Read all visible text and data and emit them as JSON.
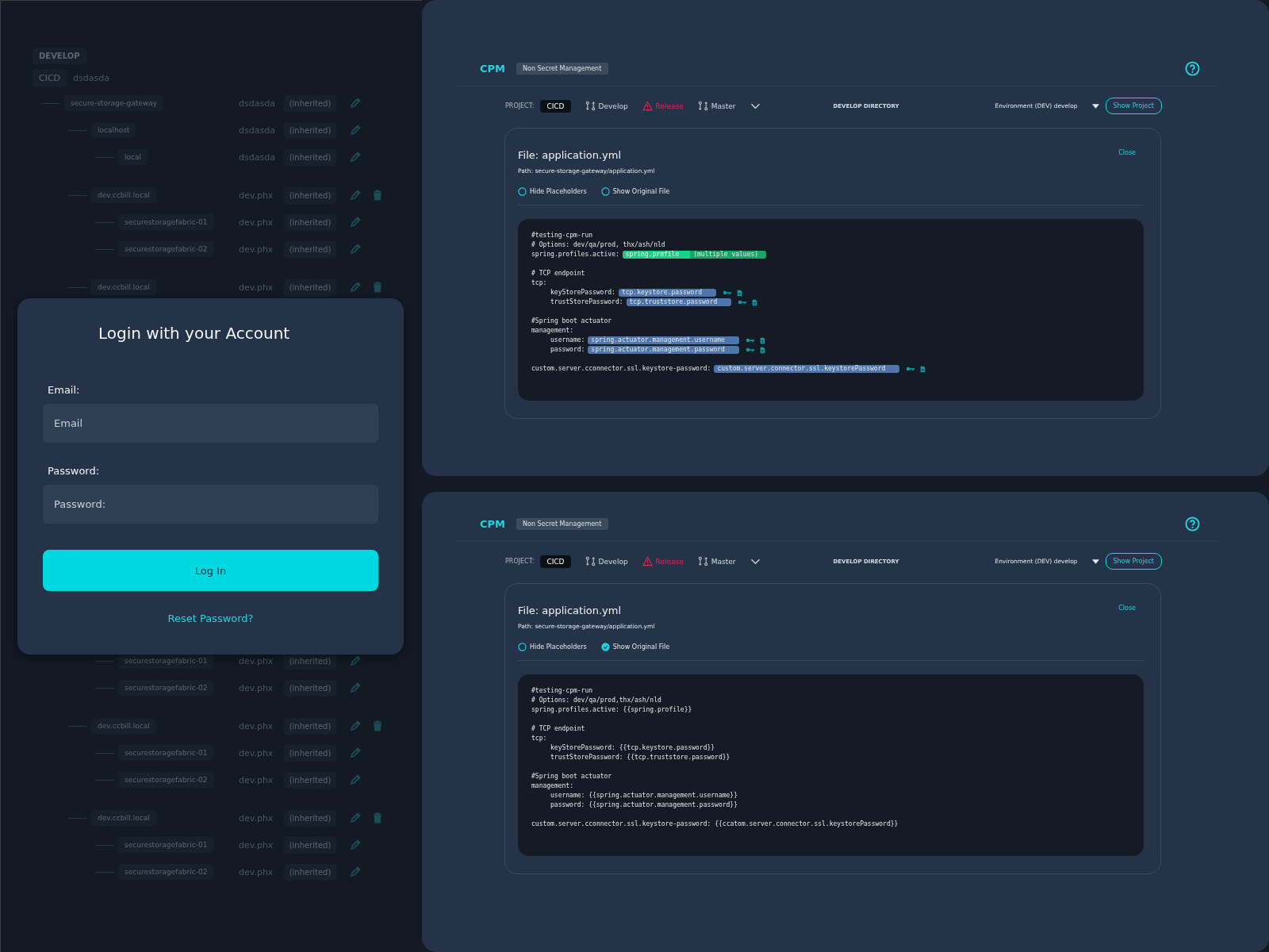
{
  "background": {
    "section": "DEVELOP",
    "project": "CICD",
    "value": "dsdasda",
    "tree": [
      {
        "name": "secure-storage-gateway",
        "value": "dsdasda",
        "tag": "(inherited)",
        "deletable": false,
        "children": [
          {
            "name": "localhost",
            "value": "dsdasda",
            "tag": "(inherited)",
            "deletable": false,
            "children": [
              {
                "name": "local",
                "value": "dsdasda",
                "tag": "(inherited)",
                "deletable": false
              }
            ]
          },
          {
            "name": "dev.ccbill.local",
            "value": "dev.phx",
            "tag": "(inherited)",
            "deletable": true,
            "children": [
              {
                "name": "securestoragefabric-01",
                "value": "dev.phx",
                "tag": "(inherited)",
                "deletable": false
              },
              {
                "name": "securestoragefabric-02",
                "value": "dev.phx",
                "tag": "(inherited)",
                "deletable": false
              }
            ]
          },
          {
            "name": "dev.ccbill.local",
            "value": "dev.phx",
            "tag": "(inherited)",
            "deletable": true
          }
        ]
      }
    ],
    "tree_lower": [
      {
        "children": [
          {
            "name": "securestoragefabric-01",
            "value": "dev.phx",
            "tag": "(inherited)",
            "deletable": false
          },
          {
            "name": "securestoragefabric-02",
            "value": "dev.phx",
            "tag": "(inherited)",
            "deletable": false
          }
        ]
      },
      {
        "name": "dev.ccbill.local",
        "value": "dev.phx",
        "tag": "(inherited)",
        "deletable": true,
        "children": [
          {
            "name": "securestoragefabric-01",
            "value": "dev.phx",
            "tag": "(inherited)",
            "deletable": false
          },
          {
            "name": "securestoragefabric-02",
            "value": "dev.phx",
            "tag": "(inherited)",
            "deletable": false
          }
        ]
      },
      {
        "name": "dev.ccbill.local",
        "value": "dev.phx",
        "tag": "(inherited)",
        "deletable": true,
        "children": [
          {
            "name": "securestoragefabric-01",
            "value": "dev.phx",
            "tag": "(inherited)",
            "deletable": false
          },
          {
            "name": "securestoragefabric-02",
            "value": "dev.phx",
            "tag": "(inherited)",
            "deletable": false
          }
        ]
      }
    ]
  },
  "login": {
    "title": "Login with your Account",
    "email_label": "Email:",
    "email_placeholder": "Email",
    "password_label": "Password:",
    "password_placeholder": "Password:",
    "button": "Log In",
    "reset_link": "Reset Password?"
  },
  "panels": [
    {
      "app": "CPM",
      "section": "Non Secret Management",
      "project_label": "PROJECT:",
      "project": "CICD",
      "branches": [
        {
          "label": "Develop",
          "kind": "branch"
        },
        {
          "label": "Release",
          "kind": "warning"
        },
        {
          "label": "Master",
          "kind": "branch"
        }
      ],
      "directory": "DEVELOP DIRECTORY",
      "environment": "Environment (DEV) develop",
      "show_button": "Show Project",
      "file": {
        "title": "File: application.yml",
        "path": "Path: secure-storage-gateway/application.yml",
        "close": "Close",
        "options": [
          {
            "label": "Hide Placeholders",
            "checked": false
          },
          {
            "label": "Show Original File",
            "checked": false
          }
        ],
        "code": [
          {
            "kind": "text",
            "text": "#testing-cpm-run"
          },
          {
            "kind": "text",
            "text": "# Options: dev/qa/prod, thx/ash/nld"
          },
          {
            "kind": "multi",
            "text": "spring.profiles.active:",
            "placeholder": "spring.profile",
            "note": "(multiple values)"
          },
          {
            "kind": "blank"
          },
          {
            "kind": "text",
            "text": "# TCP endpoint"
          },
          {
            "kind": "text",
            "text": "tcp:",
            "children": [
              {
                "kind": "placeholder",
                "text": "keyStorePassword:",
                "placeholder": "tcp.keystore.password"
              },
              {
                "kind": "placeholder",
                "text": "trustStorePassword:",
                "placeholder": "tcp.truststore.password"
              }
            ]
          },
          {
            "kind": "blank"
          },
          {
            "kind": "text",
            "text": "#Spring boot actuator"
          },
          {
            "kind": "text",
            "text": "management:",
            "children": [
              {
                "kind": "placeholder",
                "text": "username:",
                "placeholder": "spring.actuator.management.username"
              },
              {
                "kind": "placeholder",
                "text": "password:",
                "placeholder": "spring.actuator.management.password"
              }
            ]
          },
          {
            "kind": "blank"
          },
          {
            "kind": "placeholder",
            "text": "custom.server.cconnector.ssl.keystore-password:",
            "placeholder": "custom.server.connector.ssl.keystorePassword"
          }
        ]
      }
    },
    {
      "app": "CPM",
      "section": "Non Secret Management",
      "project_label": "PROJECT:",
      "project": "CICD",
      "branches": [
        {
          "label": "Develop",
          "kind": "branch"
        },
        {
          "label": "Release",
          "kind": "warning"
        },
        {
          "label": "Master",
          "kind": "branch"
        }
      ],
      "directory": "DEVELOP DIRECTORY",
      "environment": "Environment (DEV) develop",
      "show_button": "Show Project",
      "file": {
        "title": "File: application.yml",
        "path": "Path: secure-storage-gateway/application.yml",
        "close": "Close",
        "options": [
          {
            "label": "Hide Placeholders",
            "checked": false
          },
          {
            "label": "Show Original File",
            "checked": true
          }
        ],
        "code": [
          {
            "kind": "text",
            "text": "#testing-cpm-run"
          },
          {
            "kind": "text",
            "text": "# Options: dev/qa/prod,thx/ash/nld"
          },
          {
            "kind": "text",
            "text": "spring.profiles.active: {{spring.profile}}"
          },
          {
            "kind": "blank"
          },
          {
            "kind": "text",
            "text": "# TCP endpoint"
          },
          {
            "kind": "text",
            "text": "tcp:",
            "children": [
              {
                "kind": "text",
                "text": "keyStorePassword: {{tcp.keystore.password}}"
              },
              {
                "kind": "text",
                "text": "trustStorePassword: {{tcp.truststore.password}}"
              }
            ]
          },
          {
            "kind": "blank"
          },
          {
            "kind": "text",
            "text": "#Spring boot actuator"
          },
          {
            "kind": "text",
            "text": "management:",
            "children": [
              {
                "kind": "text",
                "text": "username: {{spring.actuator.management.username}}"
              },
              {
                "kind": "text",
                "text": "password: {{spring.actuator.management.password}}"
              }
            ]
          },
          {
            "kind": "blank"
          },
          {
            "kind": "text",
            "text": "custom.server.cconnector.ssl.keystore-password: {{ccatom.server.connector.ssl.keystorePassword}}"
          }
        ]
      }
    }
  ]
}
